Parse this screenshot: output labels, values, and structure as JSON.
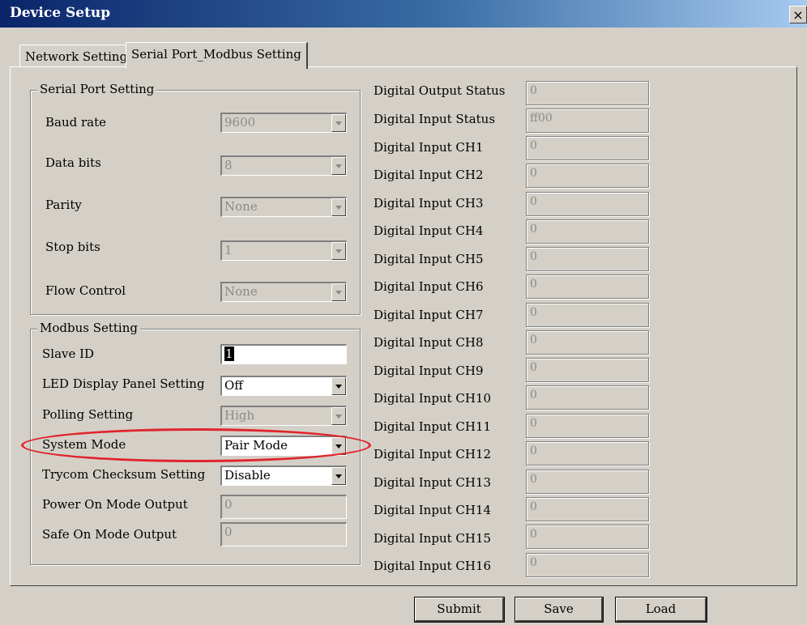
{
  "window": {
    "title": "Device Setup",
    "close_label": "×"
  },
  "tabs": [
    {
      "label": "Network Setting",
      "active": false
    },
    {
      "label": "Serial Port_Modbus Setting",
      "active": true
    }
  ],
  "serial_port": {
    "legend": "Serial Port Setting",
    "fields": [
      {
        "label": "Baud rate",
        "value": "9600"
      },
      {
        "label": "Data bits",
        "value": "8"
      },
      {
        "label": "Parity",
        "value": "None"
      },
      {
        "label": "Stop bits",
        "value": "1"
      },
      {
        "label": "Flow Control",
        "value": "None"
      }
    ]
  },
  "modbus": {
    "legend": "Modbus Setting",
    "slave_id": {
      "label": "Slave ID",
      "value": "1"
    },
    "led_display": {
      "label": "LED Display Panel Setting",
      "value": "Off"
    },
    "polling": {
      "label": "Polling Setting",
      "value": "High"
    },
    "system_mode": {
      "label": "System Mode",
      "value": "Pair Mode"
    },
    "checksum": {
      "label": "Trycom Checksum Setting",
      "value": "Disable"
    },
    "power_on": {
      "label": "Power On Mode Output",
      "value": "0"
    },
    "safe_on": {
      "label": "Safe On Mode Output",
      "value": "0"
    }
  },
  "status": [
    {
      "label": "Digital Output Status",
      "value": "0"
    },
    {
      "label": "Digital Input Status",
      "value": "ff00"
    },
    {
      "label": "Digital Input CH1",
      "value": "0"
    },
    {
      "label": "Digital Input CH2",
      "value": "0"
    },
    {
      "label": "Digital Input CH3",
      "value": "0"
    },
    {
      "label": "Digital Input CH4",
      "value": "0"
    },
    {
      "label": "Digital Input CH5",
      "value": "0"
    },
    {
      "label": "Digital Input CH6",
      "value": "0"
    },
    {
      "label": "Digital Input CH7",
      "value": "0"
    },
    {
      "label": "Digital Input CH8",
      "value": "0"
    },
    {
      "label": "Digital Input CH9",
      "value": "0"
    },
    {
      "label": "Digital Input CH10",
      "value": "0"
    },
    {
      "label": "Digital Input CH11",
      "value": "0"
    },
    {
      "label": "Digital Input CH12",
      "value": "0"
    },
    {
      "label": "Digital Input CH13",
      "value": "0"
    },
    {
      "label": "Digital Input CH14",
      "value": "0"
    },
    {
      "label": "Digital Input CH15",
      "value": "0"
    },
    {
      "label": "Digital Input CH16",
      "value": "0"
    }
  ],
  "buttons": {
    "submit": "Submit",
    "save": "Save",
    "load": "Load"
  },
  "colors": {
    "highlight_ellipse": "#e0242c",
    "titlebar": "#0a246a",
    "dialog_bg": "#d4d0c8"
  }
}
